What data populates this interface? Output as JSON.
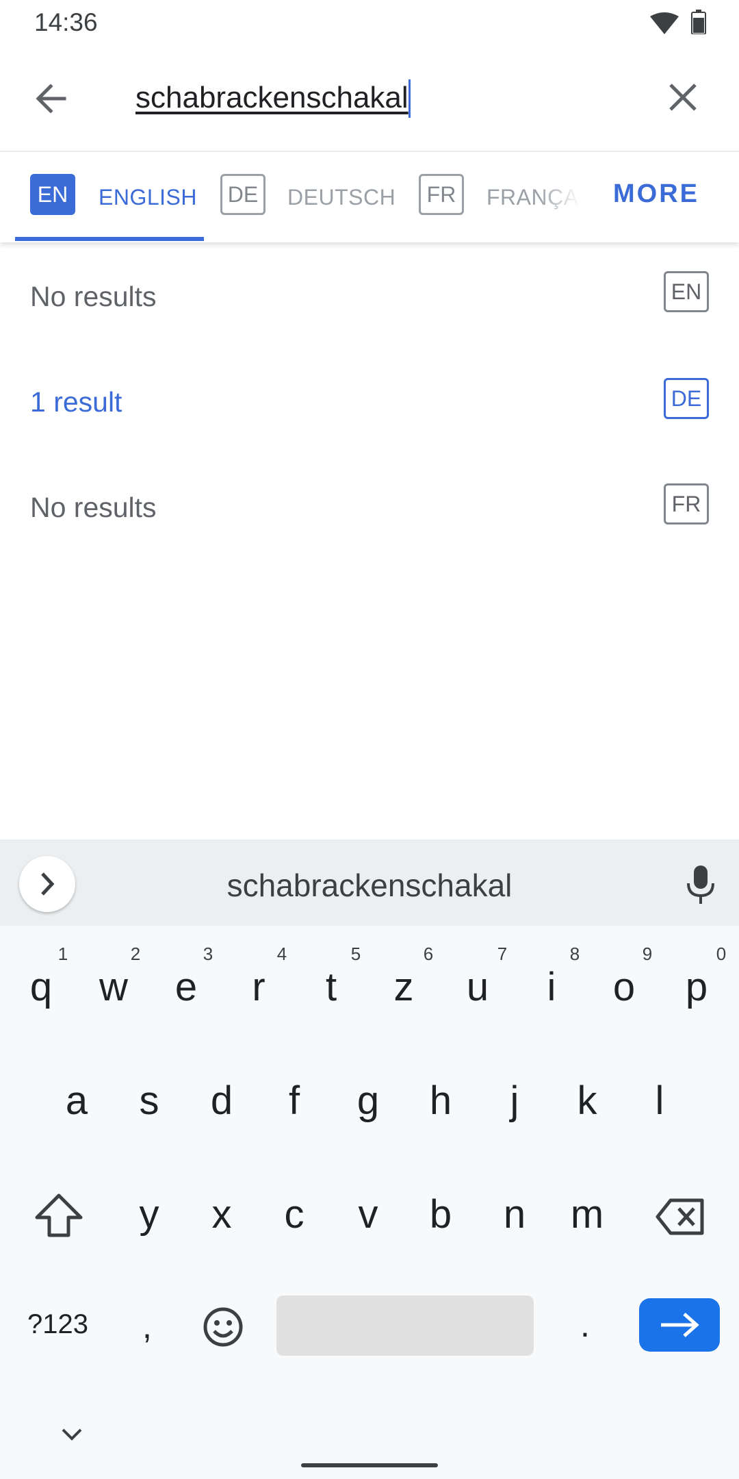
{
  "status_bar": {
    "time": "14:36"
  },
  "search": {
    "query": "schabrackenschakal"
  },
  "tabs": [
    {
      "code": "EN",
      "label": "ENGLISH"
    },
    {
      "code": "DE",
      "label": "DEUTSCH"
    },
    {
      "code": "FR",
      "label": "FRANÇAIS"
    }
  ],
  "more_label": "MORE",
  "results": [
    {
      "text": "No results",
      "code": "EN"
    },
    {
      "text": "1 result",
      "code": "DE"
    },
    {
      "text": "No results",
      "code": "FR"
    }
  ],
  "keyboard": {
    "suggestion": "schabrackenschakal",
    "row1": [
      "q",
      "w",
      "e",
      "r",
      "t",
      "z",
      "u",
      "i",
      "o",
      "p"
    ],
    "row1_hints": [
      "1",
      "2",
      "3",
      "4",
      "5",
      "6",
      "7",
      "8",
      "9",
      "0"
    ],
    "row2": [
      "a",
      "s",
      "d",
      "f",
      "g",
      "h",
      "j",
      "k",
      "l"
    ],
    "row3": [
      "y",
      "x",
      "c",
      "v",
      "b",
      "n",
      "m"
    ],
    "symbols_label": "?123",
    "comma": ",",
    "period": ".",
    "accent_color": "#1a73e8"
  },
  "colors": {
    "accent": "#3b6bd6"
  }
}
